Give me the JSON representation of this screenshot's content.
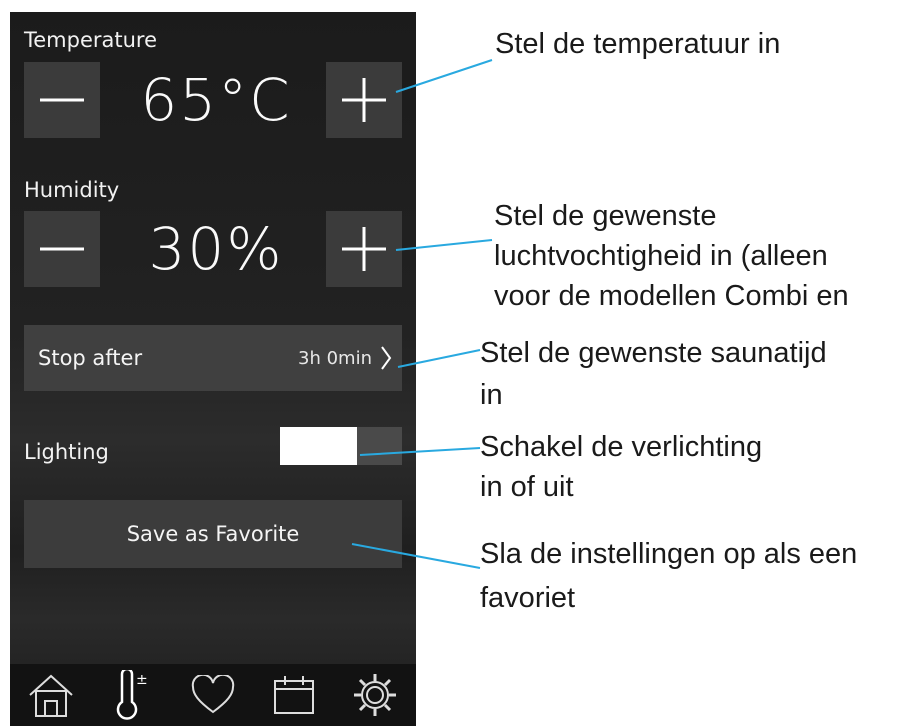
{
  "panel": {
    "temperature": {
      "label": "Temperature",
      "value": "65°C"
    },
    "humidity": {
      "label": "Humidity",
      "value": "30%"
    },
    "stop_after": {
      "label": "Stop after",
      "value": "3h 0min"
    },
    "lighting": {
      "label": "Lighting",
      "on": true
    },
    "favorite_button": "Save as Favorite",
    "tabs": [
      "home-icon",
      "thermometer-icon",
      "heart-icon",
      "calendar-icon",
      "gear-icon"
    ]
  },
  "annotations": {
    "temperature": "Stel de temperatuur in",
    "humidity_line1": "Stel de gewenste",
    "humidity_line2": "luchtvochtigheid in (alleen",
    "humidity_line3": "voor de modellen Combi en",
    "stop_line1": "Stel de gewenste saunatijd",
    "stop_line2": "in",
    "lighting_line1": "Schakel de verlichting",
    "lighting_line2": "in of uit",
    "favorite_line1": "Sla de instellingen op als een",
    "favorite_line2": "favoriet"
  },
  "colors": {
    "accent_line": "#29a9e0",
    "panel_bg": "#222222"
  }
}
